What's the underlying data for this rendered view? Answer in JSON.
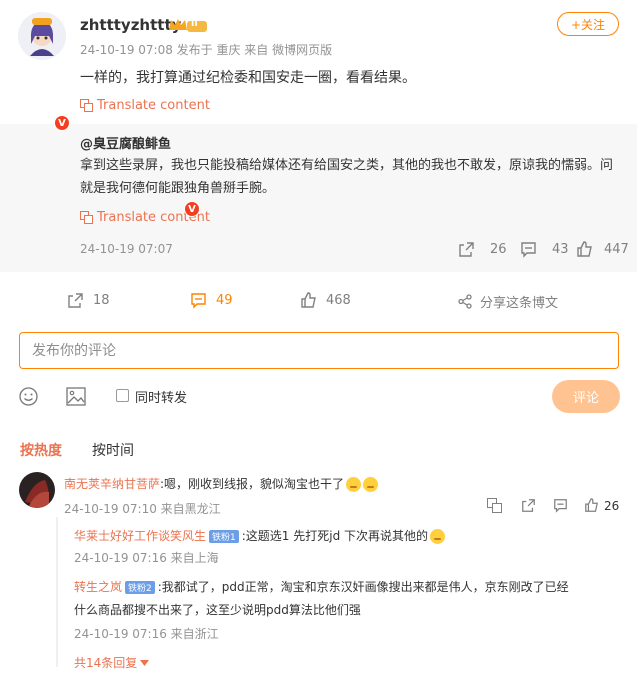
{
  "post": {
    "username": "zhtttyzhttty",
    "vip_level": "II",
    "meta": "24-10-19 07:08 发布于 重庆  来自 微博网页版",
    "follow_label": "+关注",
    "text": "一样的，我打算通过纪检委和国安走一圈，看看结果。",
    "translate_label": "Translate content"
  },
  "original": {
    "author": "@臭豆腐酿鲱鱼",
    "text": "拿到这些录屏，我也只能投稿给媒体还有给国安之类，其他的我也不敢发，原谅我的懦弱。问就是我何德何能跟独角兽掰手腕。",
    "translate_label": "Translate content",
    "time": "24-10-19 07:07",
    "reposts": "26",
    "comments": "43",
    "likes": "447"
  },
  "actions": {
    "reposts": "18",
    "comments": "49",
    "likes": "468",
    "share_label": "分享这条博文"
  },
  "composer": {
    "placeholder": "发布你的评论",
    "repost_label": "同时转发",
    "submit_label": "评论"
  },
  "sort_tabs": {
    "hot": "按热度",
    "time": "按时间"
  },
  "comments": [
    {
      "name": "南无荚辛纳甘菩萨",
      "text": ":嗯，刚收到线报，貌似淘宝也干了",
      "time": "24-10-19 07:10 来自黑龙江",
      "likes": "26"
    }
  ],
  "replies": [
    {
      "name": "华莱士好好工作谈笑风生",
      "badge": "铁粉1",
      "text": ":这题选1 先打死jd 下次再说其他的",
      "time": "24-10-19 07:16 来自上海"
    },
    {
      "name": "转生之岚",
      "badge": "铁粉2",
      "text_line1": ":我都试了，pdd正常，淘宝和京东汉奸画像搜出来都是伟人，京东刚改了已经",
      "text_line2": "什么商品都搜不出来了，这至少说明pdd算法比他们强",
      "time": "24-10-19 07:16 来自浙江"
    }
  ],
  "more_replies": "共14条回复",
  "colors": {
    "accent": "#ff8200",
    "link": "#eb7350",
    "muted": "#939393",
    "badge_blue": "#6c9ee8"
  }
}
